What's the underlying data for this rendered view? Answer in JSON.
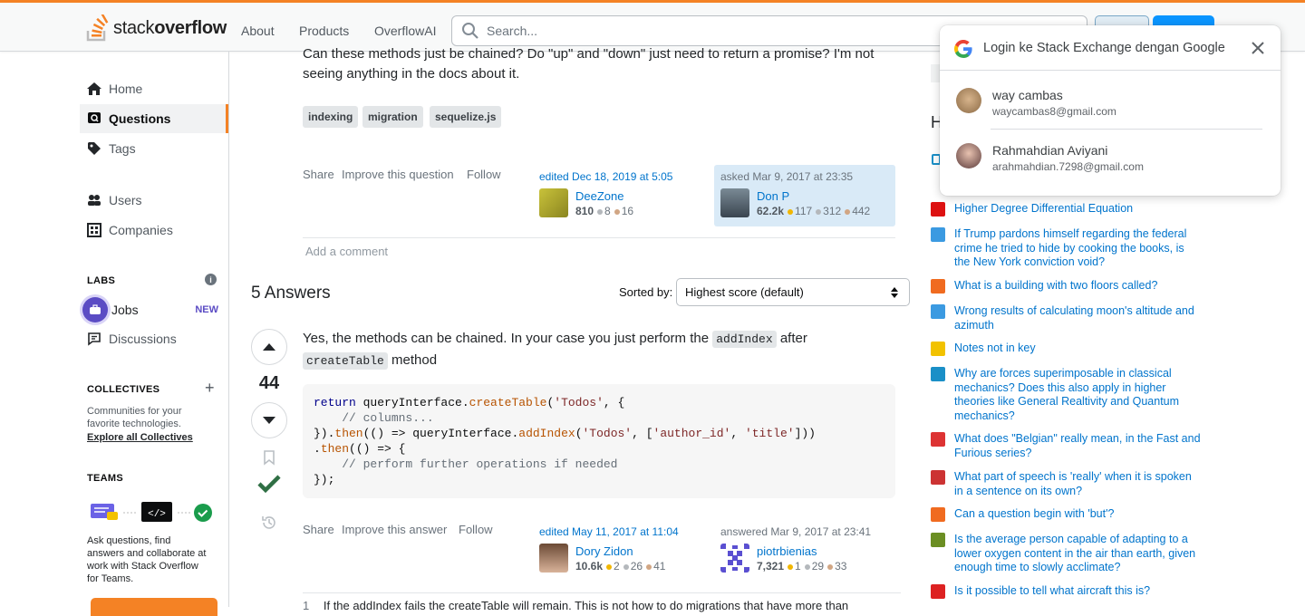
{
  "topbar": {
    "logo_text_light": "stack",
    "logo_text_bold": "overflow",
    "nav": [
      "About",
      "Products",
      "OverflowAI"
    ],
    "search_placeholder": "Search..."
  },
  "sidebar": {
    "items": [
      {
        "label": "Home",
        "icon": "home-icon"
      },
      {
        "label": "Questions",
        "icon": "questions-icon",
        "active": true
      },
      {
        "label": "Tags",
        "icon": "tag-icon"
      },
      {
        "label": "Users",
        "icon": "users-icon"
      },
      {
        "label": "Companies",
        "icon": "companies-icon"
      }
    ],
    "labs_heading": "LABS",
    "jobs_label": "Jobs",
    "jobs_badge": "NEW",
    "discussions_label": "Discussions",
    "collectives_heading": "COLLECTIVES",
    "collectives_text": "Communities for your favorite technologies.",
    "collectives_link": "Explore all Collectives",
    "teams_heading": "TEAMS",
    "teams_text": "Ask questions, find answers and collaborate at work with Stack Overflow for Teams."
  },
  "question": {
    "text_line1": "Can these methods just be chained? Do \"up\" and \"down\" just need to return a promise? I'm not",
    "text_line2": "seeing anything in the docs about it.",
    "tags": [
      "indexing",
      "migration",
      "sequelize.js"
    ],
    "menu": {
      "share": "Share",
      "improve": "Improve this question",
      "follow": "Follow"
    },
    "edited": {
      "when": "edited Dec 18, 2019 at 5:05",
      "user": "DeeZone",
      "rep": "810",
      "silver": "8",
      "bronze": "16"
    },
    "asked": {
      "when": "asked Mar 9, 2017 at 23:35",
      "user": "Don P",
      "rep": "62.2k",
      "gold": "117",
      "silver": "312",
      "bronze": "442"
    },
    "add_comment": "Add a comment"
  },
  "answers": {
    "count_label": "5 Answers",
    "sorted_by_label": "Sorted by:",
    "sort_value": "Highest score (default)"
  },
  "answer": {
    "score": "44",
    "text_before": "Yes, the methods can be chained. In your case you just perform the",
    "code1": "addIndex",
    "text_after": "after",
    "code2": "createTable",
    "text_end": "method",
    "menu": {
      "share": "Share",
      "improve": "Improve this answer",
      "follow": "Follow"
    },
    "edited": {
      "when": "edited May 11, 2017 at 11:04",
      "user": "Dory Zidon",
      "rep": "10.6k",
      "gold": "2",
      "silver": "26",
      "bronze": "41"
    },
    "answered": {
      "when": "answered Mar 9, 2017 at 23:41",
      "user": "piotrbienias",
      "rep": "7,321",
      "gold": "1",
      "silver": "29",
      "bronze": "33"
    },
    "comment_num": "1",
    "comment_text": "If the addIndex fails the createTable will remain. This is not how to do migrations that have more than"
  },
  "hot_questions": [
    {
      "title": "Higher Degree Differential Equation",
      "icon_color": "#d11"
    },
    {
      "title": "If Trump pardons himself regarding the federal crime he tried to hide by cooking the books, is the New York conviction void?",
      "icon_color": "#3b9ae1"
    },
    {
      "title": "What is a building with two floors called?",
      "icon_color": "#f06b20"
    },
    {
      "title": "Wrong results of calculating moon's altitude and azimuth",
      "icon_color": "#3b9ae1"
    },
    {
      "title": "Notes not in key",
      "icon_color": "#f2c200"
    },
    {
      "title": "Why are forces superimposable in classical mechanics? Does this also apply in higher theories like General Realtivity and Quantum mechanics?",
      "icon_color": "#1a8fc7"
    },
    {
      "title": "What does \"Belgian\" really mean, in the Fast and Furious series?",
      "icon_color": "#d33"
    },
    {
      "title": "What part of speech is 'really' when it is spoken in a sentence on its own?",
      "icon_color": "#c33"
    },
    {
      "title": "Can a question begin with 'but'?",
      "icon_color": "#f06b20"
    },
    {
      "title": "Is the average person capable of adapting to a lower oxygen content in the air than earth, given enough time to slowly acclimate?",
      "icon_color": "#6b8e23"
    },
    {
      "title": "Is it possible to tell what aircraft this is?",
      "icon_color": "#d22"
    }
  ],
  "google_popup": {
    "title": "Login ke Stack Exchange dengan Google",
    "accounts": [
      {
        "name": "way cambas",
        "email": "waycambas8@gmail.com"
      },
      {
        "name": "Rahmahdian Aviyani",
        "email": "arahmahdian.7298@gmail.com"
      }
    ]
  },
  "colors": {
    "accent": "#f48225",
    "link": "#0074cc",
    "accepted": "#2f6f44"
  }
}
